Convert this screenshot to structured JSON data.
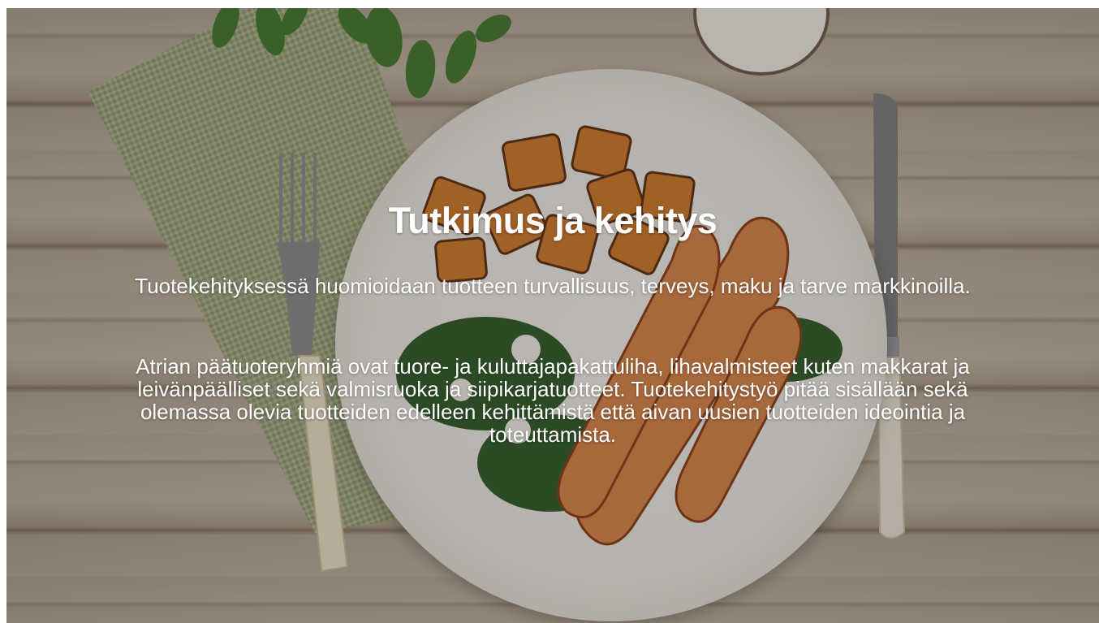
{
  "hero": {
    "title": "Tutkimus ja kehitys",
    "paragraphs": [
      "Tuotekehityksessä huomioidaan tuotteen turvallisuus, terveys, maku ja tarve markkinoilla.",
      "Atrian päätuoteryhmiä ovat tuore- ja kuluttajapakattuliha, lihavalmisteet kuten makkarat ja leivänpäälliset sekä valmisruoka ja siipikarjatuotteet. Tuotekehitystyö pitää sisällään sekä olemassa olevia tuotteiden edelleen kehittämistä että aivan uusien tuotteiden ideointia ja toteuttamista."
    ]
  }
}
